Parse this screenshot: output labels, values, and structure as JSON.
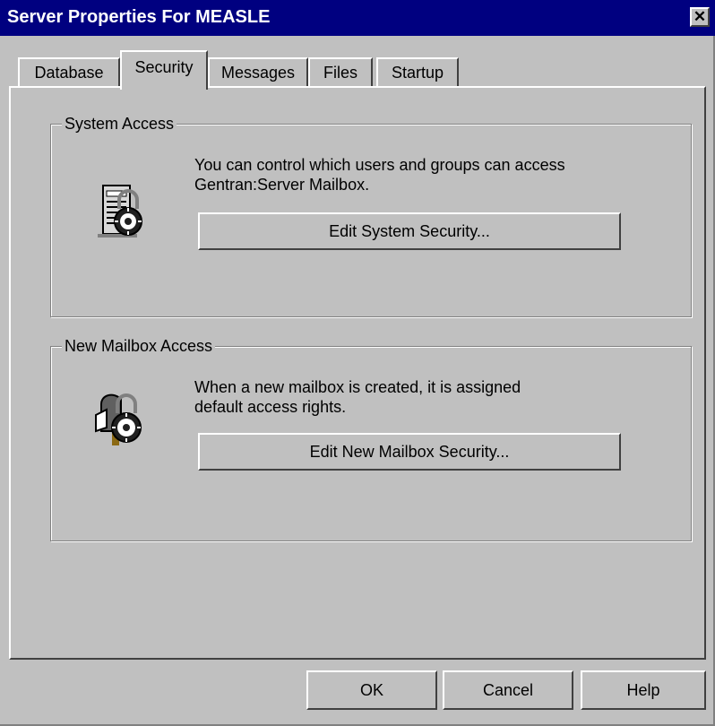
{
  "window": {
    "title": "Server Properties For MEASLE",
    "close_glyph": "✕"
  },
  "tabs": [
    {
      "label": "Database",
      "active": false
    },
    {
      "label": "Security",
      "active": true
    },
    {
      "label": "Messages",
      "active": false
    },
    {
      "label": "Files",
      "active": false
    },
    {
      "label": "Startup",
      "active": false
    }
  ],
  "system_access": {
    "title": "System Access",
    "description_line1": "You can control which users and groups can access",
    "description_line2": "Gentran:Server Mailbox.",
    "button_label": "Edit System Security...",
    "icon": "server-lock-icon"
  },
  "new_mailbox_access": {
    "title": "New Mailbox Access",
    "description_line1": "When a new mailbox is created, it is assigned",
    "description_line2": "default access rights.",
    "button_label": "Edit New Mailbox Security...",
    "icon": "mailbox-lock-icon"
  },
  "footer": {
    "ok_label": "OK",
    "cancel_label": "Cancel",
    "help_label": "Help"
  },
  "colors": {
    "titlebar": "#000080",
    "face": "#c0c0c0",
    "highlight": "#ffffff",
    "shadow": "#808080"
  }
}
